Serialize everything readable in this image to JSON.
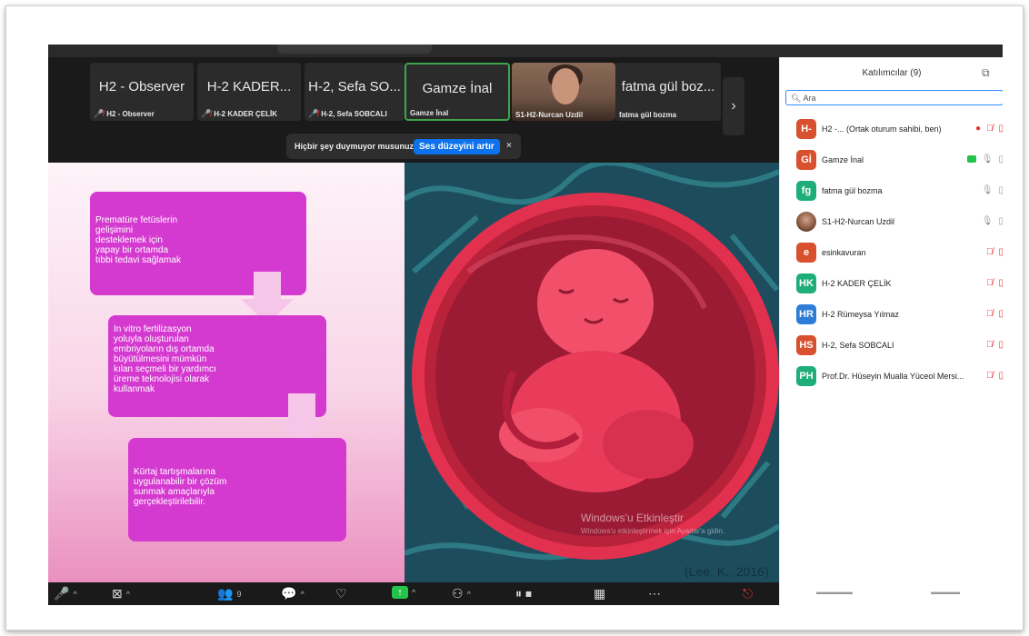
{
  "strip": {
    "tiles": [
      {
        "big": "H2 - Observer",
        "small": "H2 - Observer",
        "muted": true
      },
      {
        "big": "H-2 KADER...",
        "small": "H-2 KADER ÇELİK",
        "muted": true
      },
      {
        "big": "H-2, Sefa SO...",
        "small": "H-2, Sefa SOBCALI",
        "muted": true
      },
      {
        "big": "Gamze İnal",
        "small": "Gamze İnal",
        "muted": false
      },
      {
        "big": "",
        "small": "S1-H2-Nurcan Uzdil",
        "muted": false
      },
      {
        "big": "fatma gül boz...",
        "small": "fatma gül bozma",
        "muted": false
      }
    ],
    "next_arrow": "›"
  },
  "notice": {
    "question": "Hiçbir şey duymuyor musunuz?",
    "button": "Ses düzeyini artır",
    "close": "×"
  },
  "slide": {
    "box1": "Prematüre fetüslerin\ngelişimini\ndesteklemek için\nyapay bir ortamda\ntıbbi tedavi sağlamak",
    "box2": "In vitro fertilizasyon\nyoluyla oluşturulan\nembriyoların dış ortamda\nbüyütülmesini mümkün\nkılan seçmeli bir yardımcı\nüreme teknolojisi olarak\nkullanmak",
    "box3": "Kürtaj tartışmalarına\nuygulanabilir bir çözüm\nsunmak amaçlarıyla\ngerçekleştirilebilir.",
    "citation": "(Lee, K., 2016)"
  },
  "watermark": {
    "title": "Windows'u Etkinleştir",
    "subtitle": "Windows'u etkinleştirmek için Ayarlar'a gidin."
  },
  "toolbar": {
    "participants_count": "9",
    "caret": "^"
  },
  "panel": {
    "title": "Katılımcılar (9)",
    "search_placeholder": "Ara",
    "participants": [
      {
        "initials": "H-",
        "name": "H2 -...   (Ortak oturum sahibi, ben)",
        "color": "#d9502e",
        "recording": true,
        "mic": "muted"
      },
      {
        "initials": "Gİ",
        "name": "Gamze İnal",
        "color": "#d9502e",
        "video_on": true,
        "mic": "on"
      },
      {
        "initials": "fg",
        "name": "fatma gül bozma",
        "color": "#1fae7a",
        "mic": "on"
      },
      {
        "initials": "",
        "name": "S1-H2-Nurcan Uzdil",
        "color": "photo",
        "mic": "on"
      },
      {
        "initials": "e",
        "name": "esinkavuran",
        "color": "#d9502e",
        "mic": "muted"
      },
      {
        "initials": "HK",
        "name": "H-2 KADER ÇELİK",
        "color": "#1fae7a",
        "mic": "muted"
      },
      {
        "initials": "HR",
        "name": "H-2 Rümeysa Yılmaz",
        "color": "#2d7cd6",
        "mic": "muted"
      },
      {
        "initials": "HS",
        "name": "H-2, Sefa SOBCALI",
        "color": "#d9502e",
        "mic": "muted"
      },
      {
        "initials": "PH",
        "name": "Prof.Dr. Hüseyin Mualla Yüceol Mersi...",
        "color": "#1fae7a",
        "mic": "muted"
      }
    ]
  }
}
